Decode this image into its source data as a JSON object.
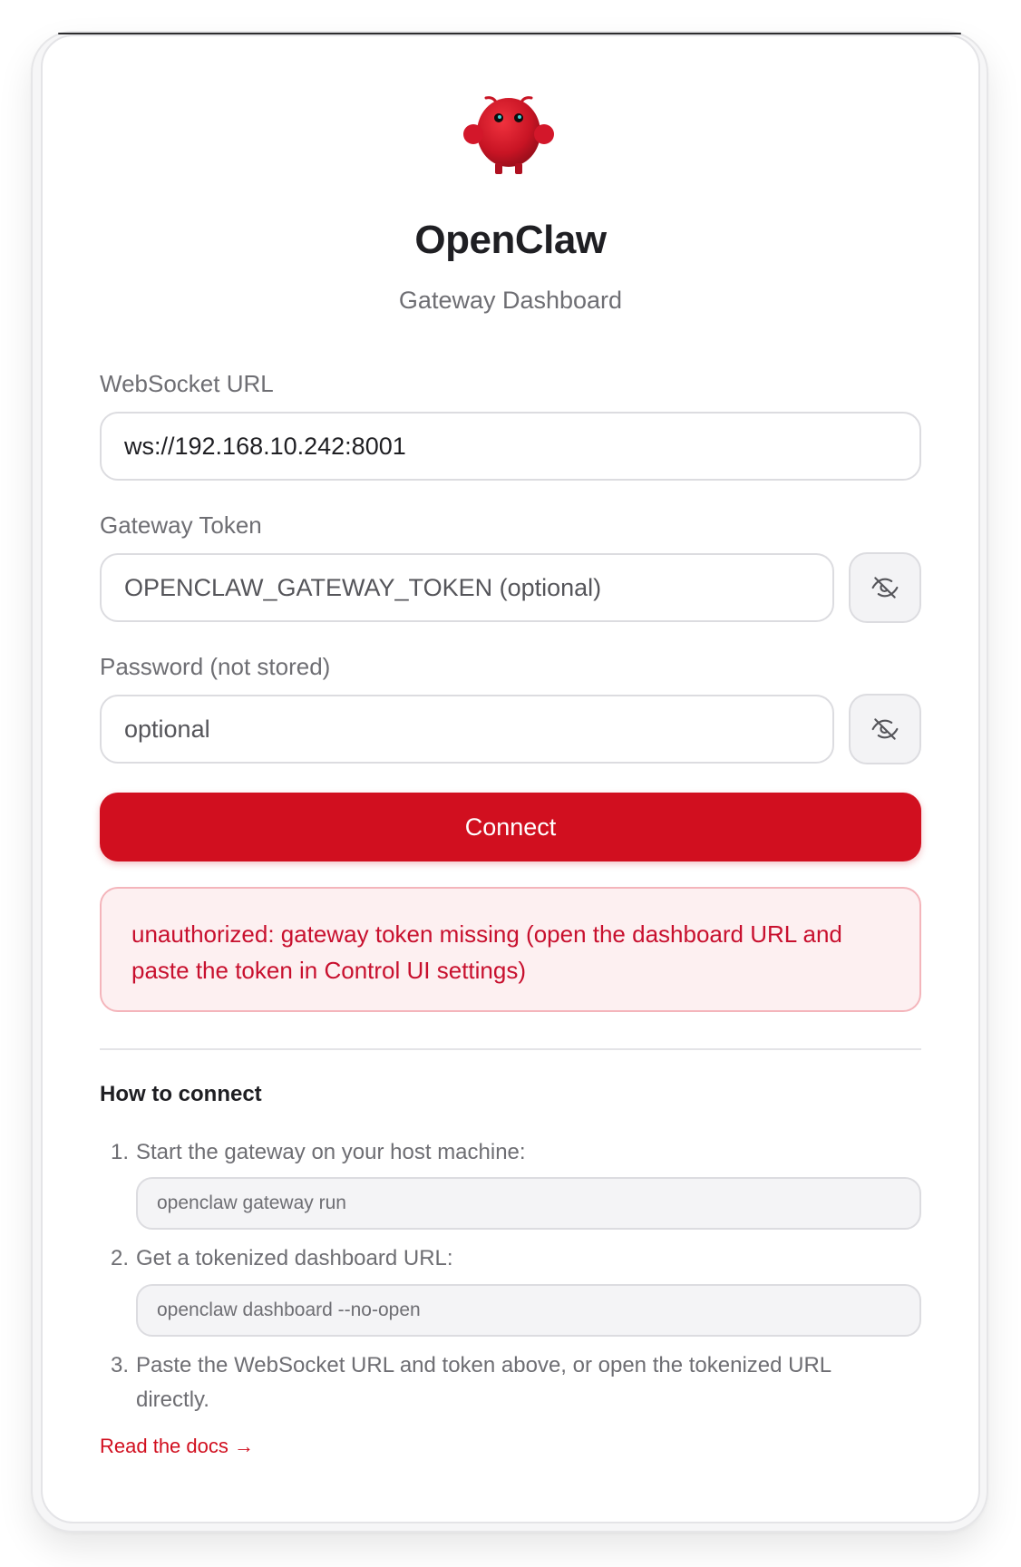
{
  "app": {
    "title": "OpenClaw",
    "subtitle": "Gateway Dashboard",
    "accent_color": "#d10f1f",
    "logo_icon": "red-claw-mascot-icon"
  },
  "form": {
    "websocket_label": "WebSocket URL",
    "websocket_value": "ws://192.168.10.242:8001",
    "token_label": "Gateway Token",
    "token_placeholder": "OPENCLAW_GATEWAY_TOKEN (optional)",
    "password_label": "Password (not stored)",
    "password_placeholder": "optional",
    "visibility_icon": "eye-off-icon",
    "connect_label": "Connect"
  },
  "error": {
    "message": "unauthorized: gateway token missing (open the dashboard URL and paste the token in Control UI settings)",
    "text_color": "#c8102e"
  },
  "howto": {
    "heading": "How to connect",
    "steps": [
      {
        "number": "1.",
        "text": "Start the gateway on your host machine:",
        "code": "openclaw gateway run"
      },
      {
        "number": "2.",
        "text": "Get a tokenized dashboard URL:",
        "code": "openclaw dashboard --no-open"
      },
      {
        "number": "3.",
        "text": "Paste the WebSocket URL and token above, or open the tokenized URL directly."
      }
    ],
    "docs_link": "Read the docs →"
  }
}
